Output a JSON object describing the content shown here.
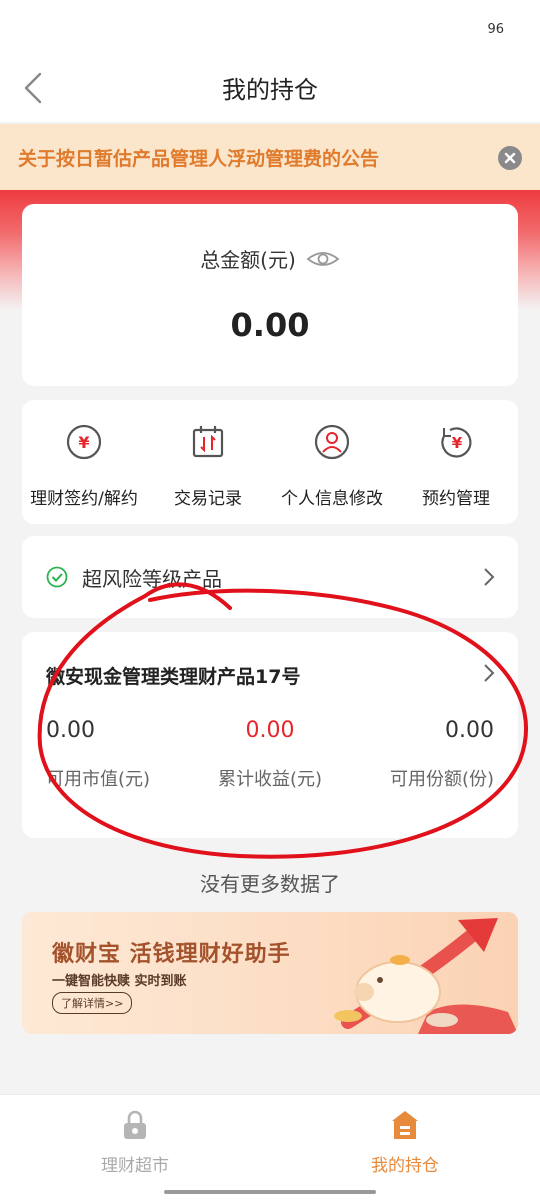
{
  "status": {
    "battery": "96"
  },
  "nav": {
    "title": "我的持仓"
  },
  "notice": {
    "text": "关于按日暂估产品管理人浮动管理费的公告"
  },
  "total": {
    "label": "总金额(元)",
    "amount": "0.00"
  },
  "functions": [
    {
      "label": "理财签约/解约",
      "icon": "yuan-circle-icon"
    },
    {
      "label": "交易记录",
      "icon": "calendar-exchange-icon"
    },
    {
      "label": "个人信息修改",
      "icon": "user-circle-icon"
    },
    {
      "label": "预约管理",
      "icon": "yuan-refresh-icon"
    }
  ],
  "risk": {
    "label": "超风险等级产品"
  },
  "product": {
    "name": "徽安现金管理类理财产品17号",
    "stats": [
      {
        "value": "0.00",
        "label": "可用市值(元)"
      },
      {
        "value": "0.00",
        "label": "累计收益(元)"
      },
      {
        "value": "0.00",
        "label": "可用份额(份)"
      }
    ]
  },
  "no_more": "没有更多数据了",
  "banner": {
    "title": "徽财宝 活钱理财好助手",
    "subtitle": "一键智能快赎 实时到账",
    "button": "了解详情>>"
  },
  "tabs": [
    {
      "label": "理财超市",
      "active": false
    },
    {
      "label": "我的持仓",
      "active": true
    }
  ],
  "colors": {
    "accent": "#e78a3c",
    "brand_red": "#e5262b",
    "notice_bg": "#fbe6cc"
  }
}
